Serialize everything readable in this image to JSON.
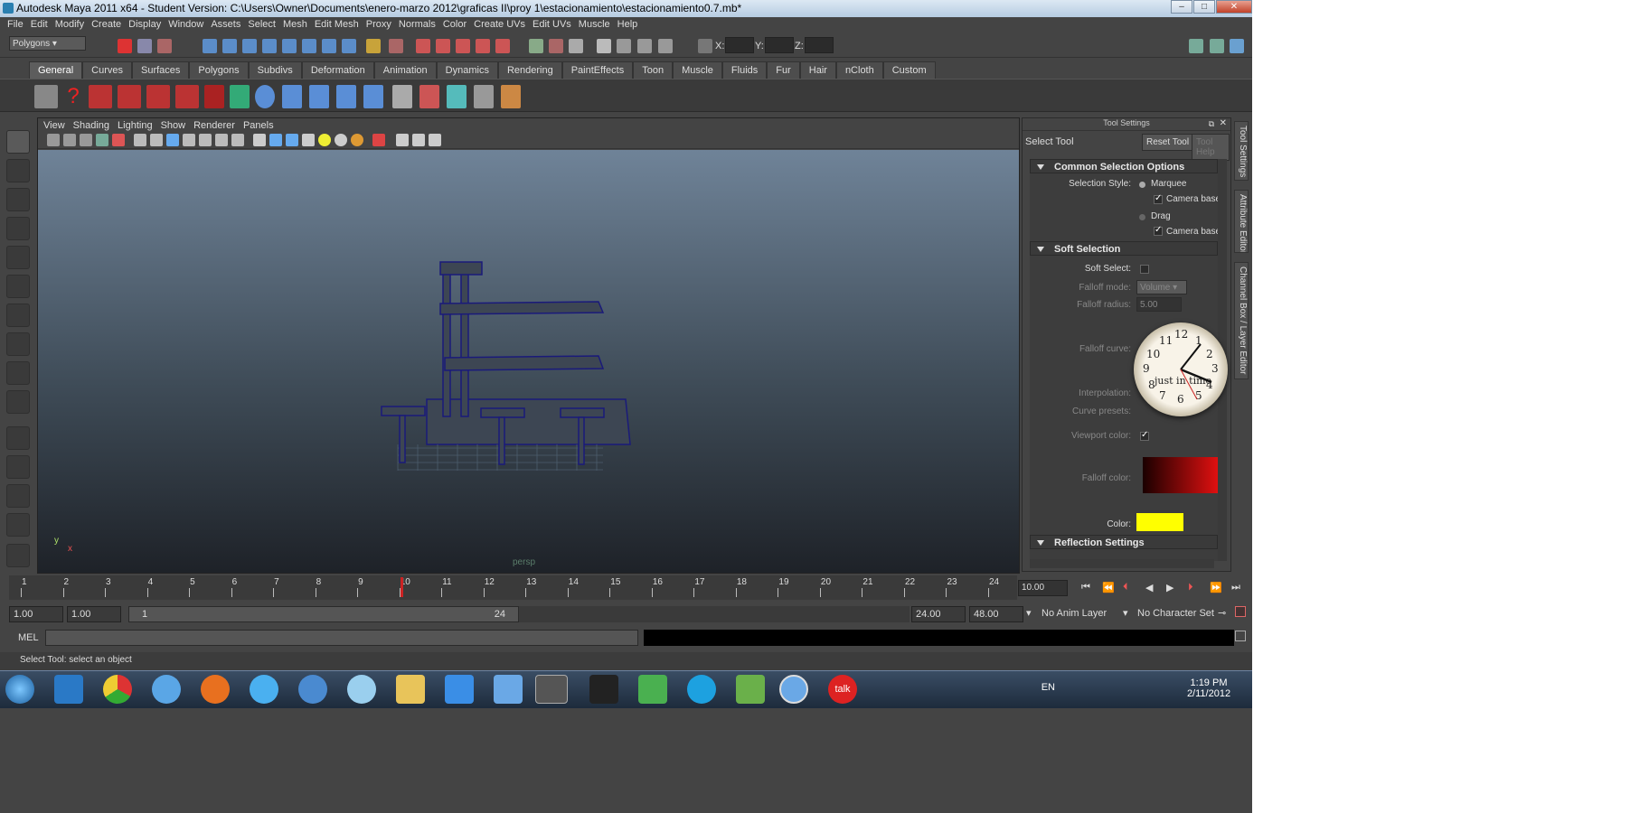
{
  "window": {
    "title": "Autodesk Maya 2011 x64 - Student Version: C:\\Users\\Owner\\Documents\\enero-marzo 2012\\graficas II\\proy 1\\estacionamiento\\estacionamiento0.7.mb*"
  },
  "menubar": [
    "File",
    "Edit",
    "Modify",
    "Create",
    "Display",
    "Window",
    "Assets",
    "Select",
    "Mesh",
    "Edit Mesh",
    "Proxy",
    "Normals",
    "Color",
    "Create UVs",
    "Edit UVs",
    "Muscle",
    "Help"
  ],
  "statusline": {
    "mode": "Polygons",
    "x_label": "X:",
    "y_label": "Y:",
    "z_label": "Z:"
  },
  "shelf_tabs": [
    "General",
    "Curves",
    "Surfaces",
    "Polygons",
    "Subdivs",
    "Deformation",
    "Animation",
    "Dynamics",
    "Rendering",
    "PaintEffects",
    "Toon",
    "Muscle",
    "Fluids",
    "Fur",
    "Hair",
    "nCloth",
    "Custom"
  ],
  "panel_menu": [
    "View",
    "Shading",
    "Lighting",
    "Show",
    "Renderer",
    "Panels"
  ],
  "viewport": {
    "camera": "persp",
    "axis_y": "y",
    "axis_x": "x"
  },
  "tool_settings": {
    "title": "Tool Settings",
    "tool_name": "Select Tool",
    "reset": "Reset Tool",
    "help": "Tool Help",
    "common": "Common Selection Options",
    "selection_style": "Selection Style:",
    "marquee": "Marquee",
    "camera_based": "Camera based",
    "drag": "Drag",
    "camera_based2": "Camera based",
    "soft": "Soft Selection",
    "soft_select": "Soft Select:",
    "falloff_mode": "Falloff mode:",
    "falloff_mode_val": "Volume",
    "falloff_radius": "Falloff radius:",
    "falloff_radius_val": "5.00",
    "falloff_curve": "Falloff curve:",
    "interpolation": "Interpolation:",
    "curve_presets": "Curve presets:",
    "viewport_color": "Viewport color:",
    "falloff_color": "Falloff color:",
    "color": "Color:",
    "reflection": "Reflection Settings"
  },
  "side_tabs": [
    "Tool Settings",
    "Attribute Editor",
    "Channel Box / Layer Editor"
  ],
  "time_slider": {
    "ticks": [
      "1",
      "2",
      "3",
      "4",
      "5",
      "6",
      "7",
      "8",
      "9",
      "10",
      "11",
      "12",
      "13",
      "14",
      "15",
      "16",
      "17",
      "18",
      "19",
      "20",
      "21",
      "22",
      "23",
      "24"
    ],
    "current": "10.00"
  },
  "range_slider": {
    "start": "1.00",
    "start2": "1.00",
    "inner_start": "1",
    "inner_end": "24",
    "end": "24.00",
    "end2": "48.00",
    "anim_layer": "No Anim Layer",
    "char_set": "No Character Set"
  },
  "cmdline": {
    "label": "MEL"
  },
  "helpline": "Select Tool: select an object",
  "clock": {
    "numbers": [
      "12",
      "1",
      "2",
      "3",
      "4",
      "5",
      "6",
      "7",
      "8",
      "9",
      "10",
      "11"
    ],
    "caption": "just in time"
  },
  "taskbar": {
    "lang": "EN",
    "time": "1:19 PM",
    "date": "2/11/2012",
    "colors": {
      "bg": "#2a3b50"
    }
  },
  "colors": {
    "maya_bg": "#444444",
    "falloff_red": "#e01010",
    "soft_color": "#ffff00"
  }
}
